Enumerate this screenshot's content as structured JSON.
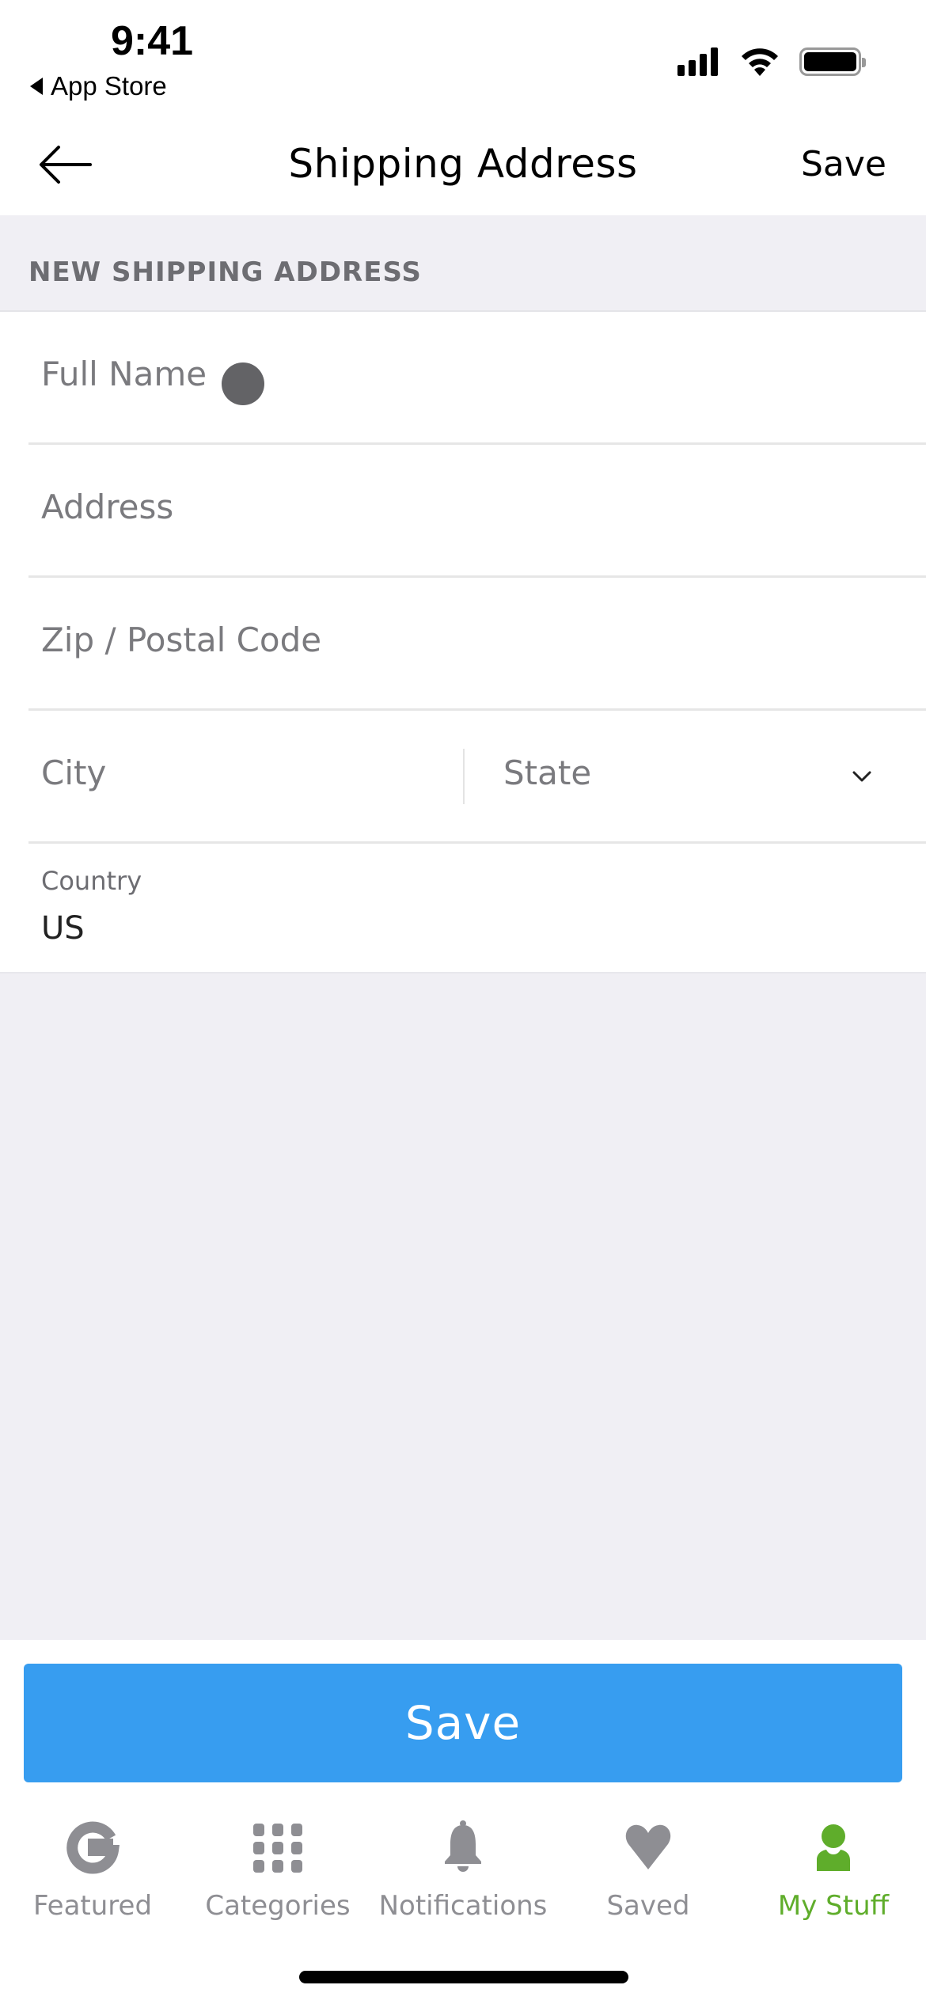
{
  "status_bar": {
    "time": "9:41",
    "back_to_app": "App Store"
  },
  "nav": {
    "title": "Shipping Address",
    "save_label": "Save",
    "back_icon": "arrow-left-icon"
  },
  "section": {
    "header": "NEW SHIPPING ADDRESS"
  },
  "form": {
    "full_name": {
      "placeholder": "Full Name",
      "value": ""
    },
    "address": {
      "placeholder": "Address",
      "value": ""
    },
    "zip": {
      "placeholder": "Zip / Postal Code",
      "value": ""
    },
    "city": {
      "placeholder": "City",
      "value": ""
    },
    "state": {
      "placeholder": "State",
      "value": ""
    },
    "country": {
      "label": "Country",
      "value": "US"
    }
  },
  "primary_button": {
    "label": "Save",
    "color": "#379df0"
  },
  "tabbar": {
    "active_color": "#5fad2b",
    "inactive_color": "#8e8e93",
    "items": [
      {
        "label": "Featured",
        "icon": "g-logo-icon",
        "active": false
      },
      {
        "label": "Categories",
        "icon": "grid-icon",
        "active": false
      },
      {
        "label": "Notifications",
        "icon": "bell-icon",
        "active": false
      },
      {
        "label": "Saved",
        "icon": "heart-icon",
        "active": false
      },
      {
        "label": "My Stuff",
        "icon": "person-icon",
        "active": true
      }
    ]
  }
}
